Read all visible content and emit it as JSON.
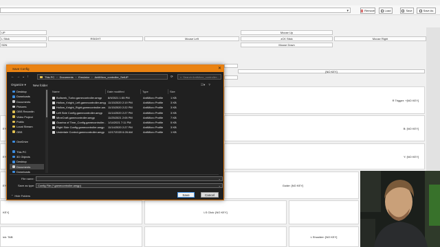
{
  "toolbar": {
    "combo_value": "",
    "remove_label": "Remove",
    "load_label": "Load",
    "save_label": "Save",
    "save_as_label": "Save As"
  },
  "bindings": {
    "left_partial": [
      "UP",
      "L Stick",
      "SDN"
    ],
    "rsight": "RSIGHT",
    "mouse_left": "Mouse Left",
    "mouse_up": "Mouse Up",
    "rck_stick": "zCK Stick",
    "mouse_right": "Mouse Right",
    "mouse_down": "Mouse Down",
    "no_key": "[NO KEY]",
    "r_trigger": "R Trigger: +[NO KEY]",
    "b_key": "B: [NO KEY]",
    "y_key": "Y: [NO KEY]",
    "guide": "Guide: [NO KEY]",
    "ls_click": "LS Click: [NO KEY]",
    "l_shoulder": "L Shoulder: [NO KEY]",
    "left_labels": [
      "EY]",
      "EY]",
      "EY]",
      "EY]",
      "KEY]",
      "ick: TAB"
    ]
  },
  "dialog": {
    "title": "Save Config",
    "close_glyph": "✕",
    "breadcrumb": [
      "This PC",
      "Documents",
      "Emulator",
      "AntiMicro_controller_SetUP"
    ],
    "search_placeholder": "Search AntiMicro_controller...",
    "organize_label": "Organize ▾",
    "new_folder_label": "New folder",
    "tree": [
      {
        "label": "Desktop",
        "color": "#3c8de0"
      },
      {
        "label": "Downloads",
        "color": "#3c8de0"
      },
      {
        "label": "Documents",
        "color": "#cfcfcf"
      },
      {
        "label": "Pictures",
        "color": "#cfcfcf"
      },
      {
        "label": "OBS Recordin",
        "color": "#e0c050"
      },
      {
        "label": "Video Project",
        "color": "#e0c050"
      },
      {
        "label": "Public",
        "color": "#e0c050"
      },
      {
        "label": "Local Stream",
        "color": "#e0c050"
      },
      {
        "label": "OBS",
        "color": "#e0c050"
      },
      {
        "label": "",
        "color": ""
      },
      {
        "label": "OneDrive",
        "color": "#3c8de0"
      },
      {
        "label": "",
        "color": ""
      },
      {
        "label": "This PC",
        "color": "#3c8de0"
      },
      {
        "label": "3D Objects",
        "color": "#3c8de0"
      },
      {
        "label": "Desktop",
        "color": "#3c8de0"
      },
      {
        "label": "Documents",
        "color": "#cfcfcf",
        "selected": true
      },
      {
        "label": "Downloads",
        "color": "#3c8de0"
      }
    ],
    "columns": [
      "Name",
      "Date modified",
      "Type",
      "Size"
    ],
    "files": [
      {
        "name": "Bullseek_Turbo.gamecontroller.amgp",
        "date": "8/9/2021 1:55 PM",
        "type": "AntiMicro Profile",
        "size": "1 KB"
      },
      {
        "name": "Hollow_Knight_Left.gamecontroller.amgp",
        "date": "11/15/2020 2:19 PM",
        "type": "AntiMicro Profile",
        "size": "3 KB"
      },
      {
        "name": "Hollow_Knight_Right.gamecontroller.am...",
        "date": "11/15/2020 2:22 PM",
        "type": "AntiMicro Profile",
        "size": "3 KB"
      },
      {
        "name": "Left Side Config.gamecontroller.amgp",
        "date": "11/14/2020 2:27 PM",
        "type": "AntiMicro Profile",
        "size": "3 KB"
      },
      {
        "name": "MineCraft.gamecontroller.amgp",
        "date": "11/25/2021 2:05 PM",
        "type": "AntiMicro Profile",
        "size": "7 KB"
      },
      {
        "name": "Ocarina of Time_Config.gamecontroller...",
        "date": "1/14/2021 7:11 PM",
        "type": "AntiMicro Profile",
        "size": "5 KB"
      },
      {
        "name": "Right Side Config.gamecontroller.amgp",
        "date": "11/14/2020 2:27 PM",
        "type": "AntiMicro Profile",
        "size": "3 KB"
      },
      {
        "name": "Undertale Control.gamecontroller.amgp",
        "date": "12/17/2020 6:26 AM",
        "type": "AntiMicro Profile",
        "size": "1 KB"
      }
    ],
    "file_name_label": "File name:",
    "file_name_value": "",
    "save_type_label": "Save as type:",
    "save_type_value": "Config File (*.gamecontroller.amgp)",
    "hide_folders_label": "Hide Folders",
    "save_button": "Save",
    "cancel_button": "Cancel"
  }
}
